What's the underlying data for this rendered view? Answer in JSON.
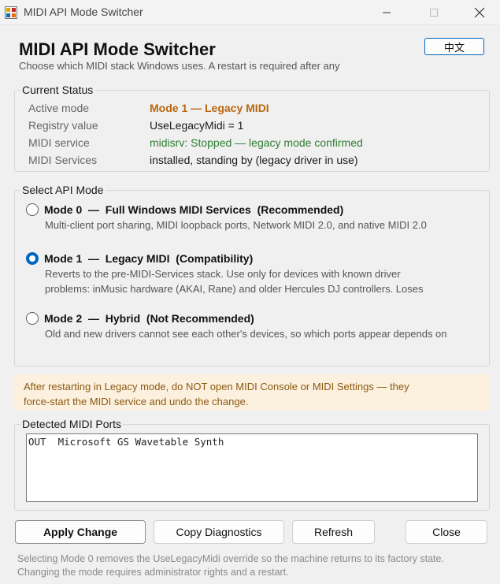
{
  "window": {
    "title": "MIDI API Mode Switcher",
    "icons": {
      "app": "midi-app-icon",
      "minimize": "minimize-icon",
      "maximize": "maximize-icon",
      "close": "close-icon"
    }
  },
  "header": {
    "title": "MIDI API Mode Switcher",
    "subtitle": "Choose which MIDI stack Windows uses. A restart is required after any",
    "language_button": "中文"
  },
  "status": {
    "legend": "Current Status",
    "rows": [
      {
        "label": "Active mode",
        "value": "Mode 1 — Legacy MIDI"
      },
      {
        "label": "Registry value",
        "value": "UseLegacyMidi = 1"
      },
      {
        "label": "MIDI service",
        "value": "midisrv: Stopped — legacy mode confirmed"
      },
      {
        "label": "MIDI Services",
        "value": "installed, standing by (legacy driver in use)"
      }
    ]
  },
  "modes": {
    "legend": "Select API Mode",
    "selected": 1,
    "options": [
      {
        "title": "Mode 0  —  Full Windows MIDI Services  (Recommended)",
        "desc": [
          "Multi-client port sharing, MIDI loopback ports, Network MIDI 2.0, and native MIDI 2.0"
        ]
      },
      {
        "title": "Mode 1  —  Legacy MIDI  (Compatibility)",
        "desc": [
          "Reverts to the pre-MIDI-Services stack. Use only for devices with known driver",
          "problems: inMusic hardware (AKAI, Rane) and older Hercules DJ controllers. Loses"
        ]
      },
      {
        "title": "Mode 2  —  Hybrid  (Not Recommended)",
        "desc": [
          "Old and new drivers cannot see each other's devices, so which ports appear depends on"
        ]
      }
    ]
  },
  "warning": {
    "lines": [
      "After restarting in Legacy mode, do NOT open MIDI Console or MIDI Settings — they",
      "force-start the MIDI service and undo the change."
    ]
  },
  "ports": {
    "legend": "Detected MIDI Ports",
    "list": "OUT  Microsoft GS Wavetable Synth"
  },
  "buttons": {
    "apply": "Apply Change",
    "copy": "Copy Diagnostics",
    "refresh": "Refresh",
    "close": "Close"
  },
  "footer": {
    "lines": [
      "Selecting Mode 0 removes the UseLegacyMidi override so the machine returns to its factory state.",
      "Changing the mode requires administrator rights and a restart."
    ]
  },
  "colors": {
    "accent": "#0067c0",
    "mode_value": "#b8670f",
    "ok_value": "#2e7d32",
    "warning_bg": "#fcf0de",
    "warning_text": "#8a5a12"
  }
}
